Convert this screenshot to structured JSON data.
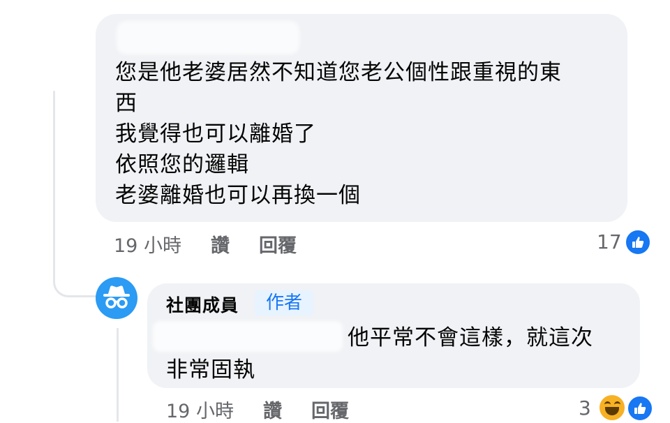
{
  "comment1": {
    "text": "您是他老婆居然不知道您老公個性跟重視的東\n西\n我覺得也可以離婚了\n依照您的邏輯\n老婆離婚也可以再換一個",
    "time": "19 小時",
    "like_label": "讚",
    "reply_label": "回覆",
    "reaction_count": "17",
    "reactions": [
      "like-icon"
    ]
  },
  "reply": {
    "author": "社團成員",
    "badge": "作者",
    "text_line1": "他平常不會這樣，就這次",
    "text_line2": "非常固執",
    "time": "19 小時",
    "like_label": "讚",
    "reply_label": "回覆",
    "reaction_count": "3",
    "reactions": [
      "haha-icon",
      "like-icon"
    ]
  },
  "colors": {
    "accent": "#1877f2",
    "bubble": "#f0f2f5",
    "meta_text": "#65676b",
    "avatar": "#2b9bf4"
  }
}
